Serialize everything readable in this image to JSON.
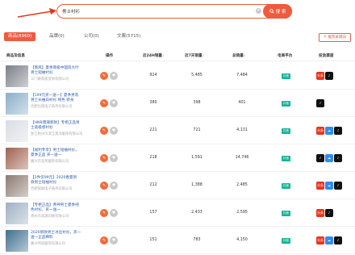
{
  "search": {
    "value": "男士衬衫",
    "clear_icon": "close-icon",
    "button_label": "搜 索"
  },
  "tabs": [
    {
      "label": "商品(8960)",
      "active": true
    },
    {
      "label": "品牌(0)",
      "active": false
    },
    {
      "label": "公司(0)",
      "active": false
    },
    {
      "label": "文案(5715)",
      "active": false
    }
  ],
  "share_label": "推荐关键词",
  "columns": [
    "商品及信息",
    "操作",
    "近24H销量",
    "近7天销量",
    "总销量",
    "电商平台",
    "投放渠道"
  ],
  "colors": {
    "accent": "#f05a3e",
    "platform": "#18b397",
    "link": "#2b5cab"
  },
  "rows": [
    {
      "title_l1": "【南风】夏季南极中国风大叶",
      "title_l2": "男士短袖衬衫",
      "shop": "三门峡南极贸易有限公司",
      "h24": "924",
      "d7": "5,485",
      "total": "7,484",
      "platform": "抖音",
      "thumb": "#7a808a",
      "channels": [
        "red",
        "tt"
      ]
    },
    {
      "title_l1": "【199元买一送一】夏季男装",
      "title_l2": "男士长袖白衬衫 纯色 修身",
      "shop": "合肥比南电子商务有限公司",
      "h24": "380",
      "d7": "398",
      "total": "401",
      "platform": "抖音",
      "thumb": "#8aaec8",
      "channels": [
        "tt"
      ]
    },
    {
      "title_l1": "【HNB港潮新款】专柜正品男",
      "title_l2": "士高级感衬衫",
      "shop": "浙江杭州市滨江奥洋服饰有限公司",
      "h24": "221",
      "d7": "721",
      "total": "4,131",
      "platform": "抖音",
      "thumb": "#d9dde3",
      "channels": [
        "red",
        "blue",
        "tt"
      ]
    },
    {
      "title_l1": "【福利专享】男士短袖衬衫，",
      "title_l2": "夏季正品 买一送一",
      "shop": "嘉兴市浩邦服饰有限公司",
      "h24": "218",
      "d7": "1,591",
      "total": "14,746",
      "platform": "抖音",
      "thumb": "#a0624e",
      "channels": [
        "tt",
        "blue",
        "tt"
      ]
    },
    {
      "title_l1": "【2件仅99元】2020春夏新",
      "title_l2": "款男士短袖衬衫",
      "shop": "合肥锐丽电子商务有限公司",
      "h24": "212",
      "d7": "1,388",
      "total": "2,485",
      "platform": "抖音",
      "thumb": "#8b7b6f",
      "channels": [
        "red",
        "blue",
        "tt"
      ]
    },
    {
      "title_l1": "【专柜正品】青神男士夏季纯",
      "title_l2": "色衬衫，买一送一",
      "shop": "青州市海源印刷有限公司",
      "h24": "157",
      "d7": "2,433",
      "total": "2,595",
      "platform": "抖音",
      "thumb": "#9fb1c3",
      "channels": [
        "red",
        "tt"
      ]
    },
    {
      "title_l1": "2020新款男士冰丝衬衫，买一",
      "title_l2": "送一正品棉料",
      "shop": "嘉兴时间服饰有限公司",
      "h24": "151",
      "d7": "783",
      "total": "4,150",
      "platform": "抖音",
      "thumb": "#3f6f8f",
      "channels": [
        "red",
        "blue",
        "tt"
      ]
    }
  ]
}
